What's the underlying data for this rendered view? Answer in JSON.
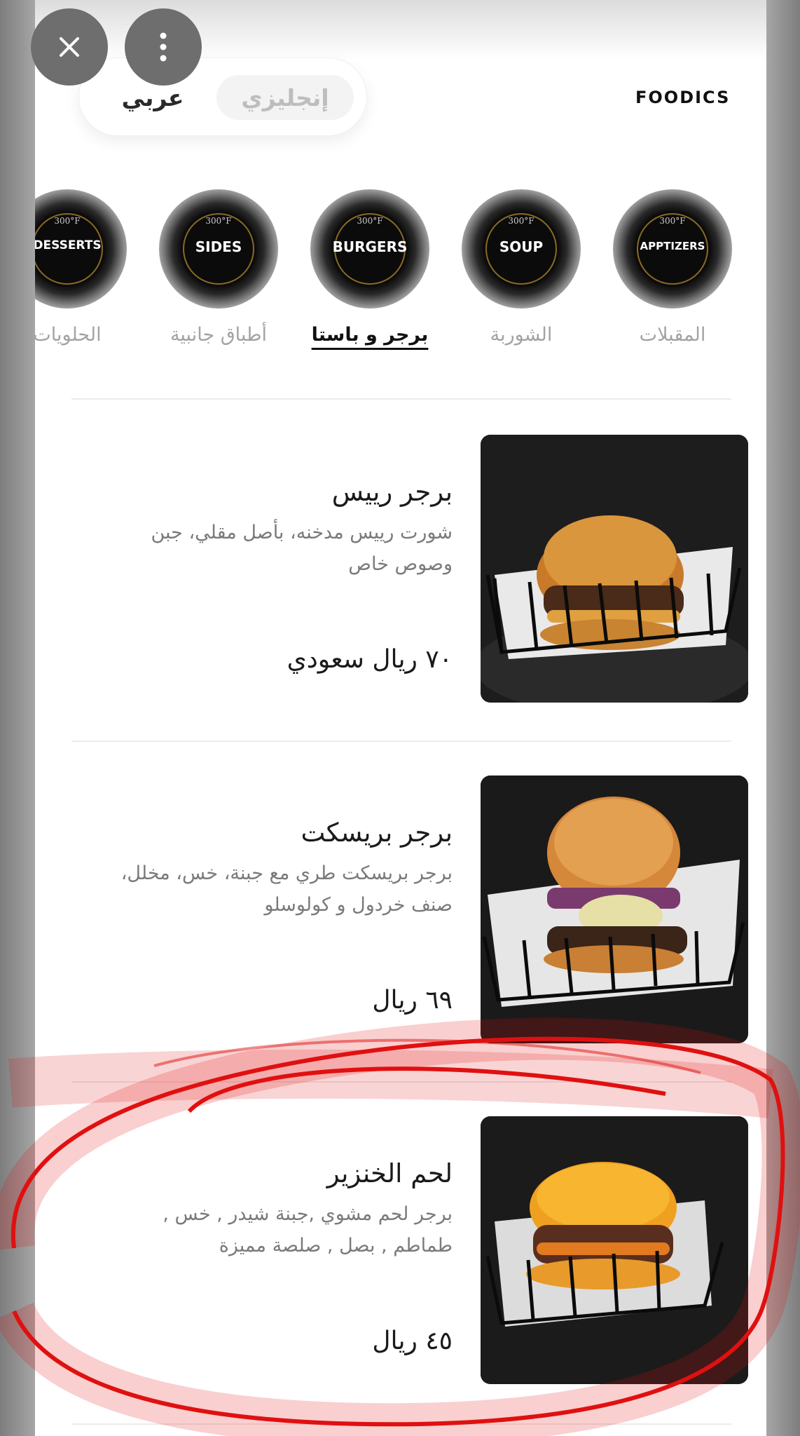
{
  "header": {
    "close_icon": "close-icon",
    "more_icon": "more-vertical-icon",
    "language": {
      "english_label": "إنجليزي",
      "arabic_label": "عربي",
      "active": "arabic"
    },
    "logo_text": "FOODICS"
  },
  "categories": [
    {
      "badge_temp": "300°F",
      "badge_label": "APPTIZERS",
      "label": "المقبلات",
      "active": false
    },
    {
      "badge_temp": "300°F",
      "badge_label": "SOUP",
      "label": "الشوربة",
      "active": false
    },
    {
      "badge_temp": "300°F",
      "badge_label": "BURGERS",
      "label": "برجر و باستا",
      "active": true
    },
    {
      "badge_temp": "300°F",
      "badge_label": "SIDES",
      "label": "أطباق جانبية",
      "active": false
    },
    {
      "badge_temp": "300°F",
      "badge_label": "DESSERTS",
      "label": "الحلويات",
      "active": false
    }
  ],
  "menu_items": [
    {
      "name": "برجر رييس",
      "description": "شورت رييس مدخنه، بأصل مقلي، جبن وصوص خاص",
      "price": "٧٠ ريال سعودي",
      "image": "burger-photo"
    },
    {
      "name": "برجر بريسكت",
      "description": "برجر بريسكت طري مع جبنة، خس، مخلل، صنف خردول و كولوسلو",
      "price": "٦٩ ريال",
      "image": "burger-photo"
    },
    {
      "name": "لحم الخنزير",
      "description": "برجر لحم مشوي ,جبنة شيدر , خس , طماطم , بصل , صلصة مميزة",
      "price": "٤٥ ريال",
      "image": "burger-photo"
    }
  ],
  "overlay": {
    "favorite_icon": "heart-icon",
    "share_icon": "share-icon",
    "annotation_color": "#e01010"
  },
  "colors": {
    "background": "#ffffff",
    "inactive_text": "#a3a3a3",
    "active_text": "#111111",
    "annotation": "#e01010"
  }
}
